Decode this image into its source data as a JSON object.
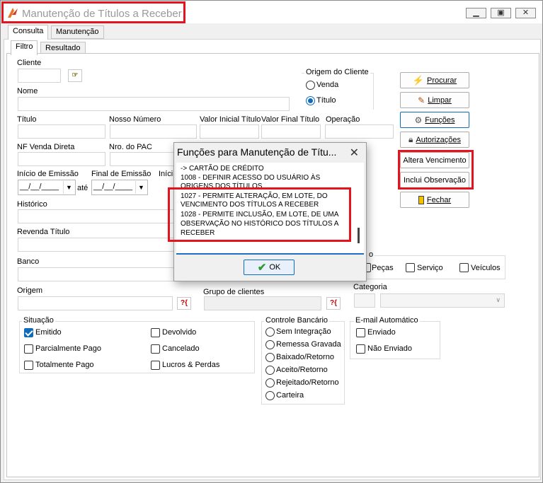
{
  "window": {
    "title": "Manutenção de Títulos a Receber",
    "controls": [
      "minimize",
      "restore",
      "close"
    ]
  },
  "tabs_main": [
    {
      "label": "Consulta"
    },
    {
      "label": "Manutenção"
    }
  ],
  "tabs_sub": [
    {
      "label": "Filtro"
    },
    {
      "label": "Resultado"
    }
  ],
  "form": {
    "cliente": "Cliente",
    "nome": "Nome",
    "titulo": "Título",
    "nosso_numero": "Nosso Número",
    "valor_inicial": "Valor Inicial Título",
    "valor_final": "Valor Final Título",
    "operacao": "Operação",
    "nf_venda": "NF Venda Direta",
    "nro_pac": "Nro. do PAC",
    "inicio_emissao": "Início de Emissão",
    "final_emissao": "Final de Emissão",
    "inicio_trunc": "Iníci",
    "date_mask": "__/__/____",
    "ate": "até",
    "historico": "Histórico",
    "revenda": "Revenda Título",
    "banco": "Banco",
    "origem": "Origem",
    "grupo_clientes": "Grupo de clientes",
    "categoria": "Categoria",
    "tipo_trunc": "o"
  },
  "origem_cliente": {
    "title": "Origem do Cliente",
    "options": [
      {
        "label": "Venda",
        "selected": false
      },
      {
        "label": "Título",
        "selected": true
      }
    ]
  },
  "tipo": {
    "options": [
      {
        "label": "Peças",
        "checked": false
      },
      {
        "label": "Serviço",
        "checked": false
      },
      {
        "label": "Veículos",
        "checked": false
      }
    ]
  },
  "situacao": {
    "title": "Situação",
    "items": [
      {
        "label": "Emitido",
        "checked": true
      },
      {
        "label": "Parcialmente Pago",
        "checked": false
      },
      {
        "label": "Totalmente Pago",
        "checked": false
      },
      {
        "label": "Devolvido",
        "checked": false
      },
      {
        "label": "Cancelado",
        "checked": false
      },
      {
        "label": "Lucros & Perdas",
        "checked": false
      }
    ]
  },
  "controle_bancario": {
    "title": "Controle Bancário",
    "items": [
      "Sem Integração",
      "Remessa Gravada",
      "Baixado/Retorno",
      "Aceito/Retorno",
      "Rejeitado/Retorno",
      "Carteira"
    ]
  },
  "email": {
    "title": "E-mail Automático",
    "items": [
      {
        "label": "Enviado",
        "checked": false
      },
      {
        "label": "Não Enviado",
        "checked": false
      }
    ]
  },
  "buttons": {
    "procurar": "Procurar",
    "limpar": "Limpar",
    "funcoes": "Funções",
    "autorizacoes": "Autorizações",
    "altera_venc": "Altera Vencimento",
    "inclui_obs": "Inclui Observação",
    "fechar": "Fechar"
  },
  "dialog": {
    "title": "Funções para Manutenção de Títu...",
    "lines": [
      "-> CARTÃO DE CRÉDITO",
      "1008 - DEFINIR ACESSO DO USUÁRIO ÀS",
      "ORIGENS DOS TÍTULOS",
      "1027 - PERMITE ALTERAÇÃO, EM LOTE, DO",
      "VENCIMENTO DOS TÍTULOS A RECEBER",
      "1028 - PERMITE INCLUSÃO, EM LOTE, DE UMA",
      "OBSERVAÇÃO NO HISTÓRICO DOS TÍTULOS A",
      "RECEBER"
    ],
    "ok": "OK"
  },
  "colors": {
    "accent": "#0f6cbd",
    "highlight": "#e3141e"
  }
}
